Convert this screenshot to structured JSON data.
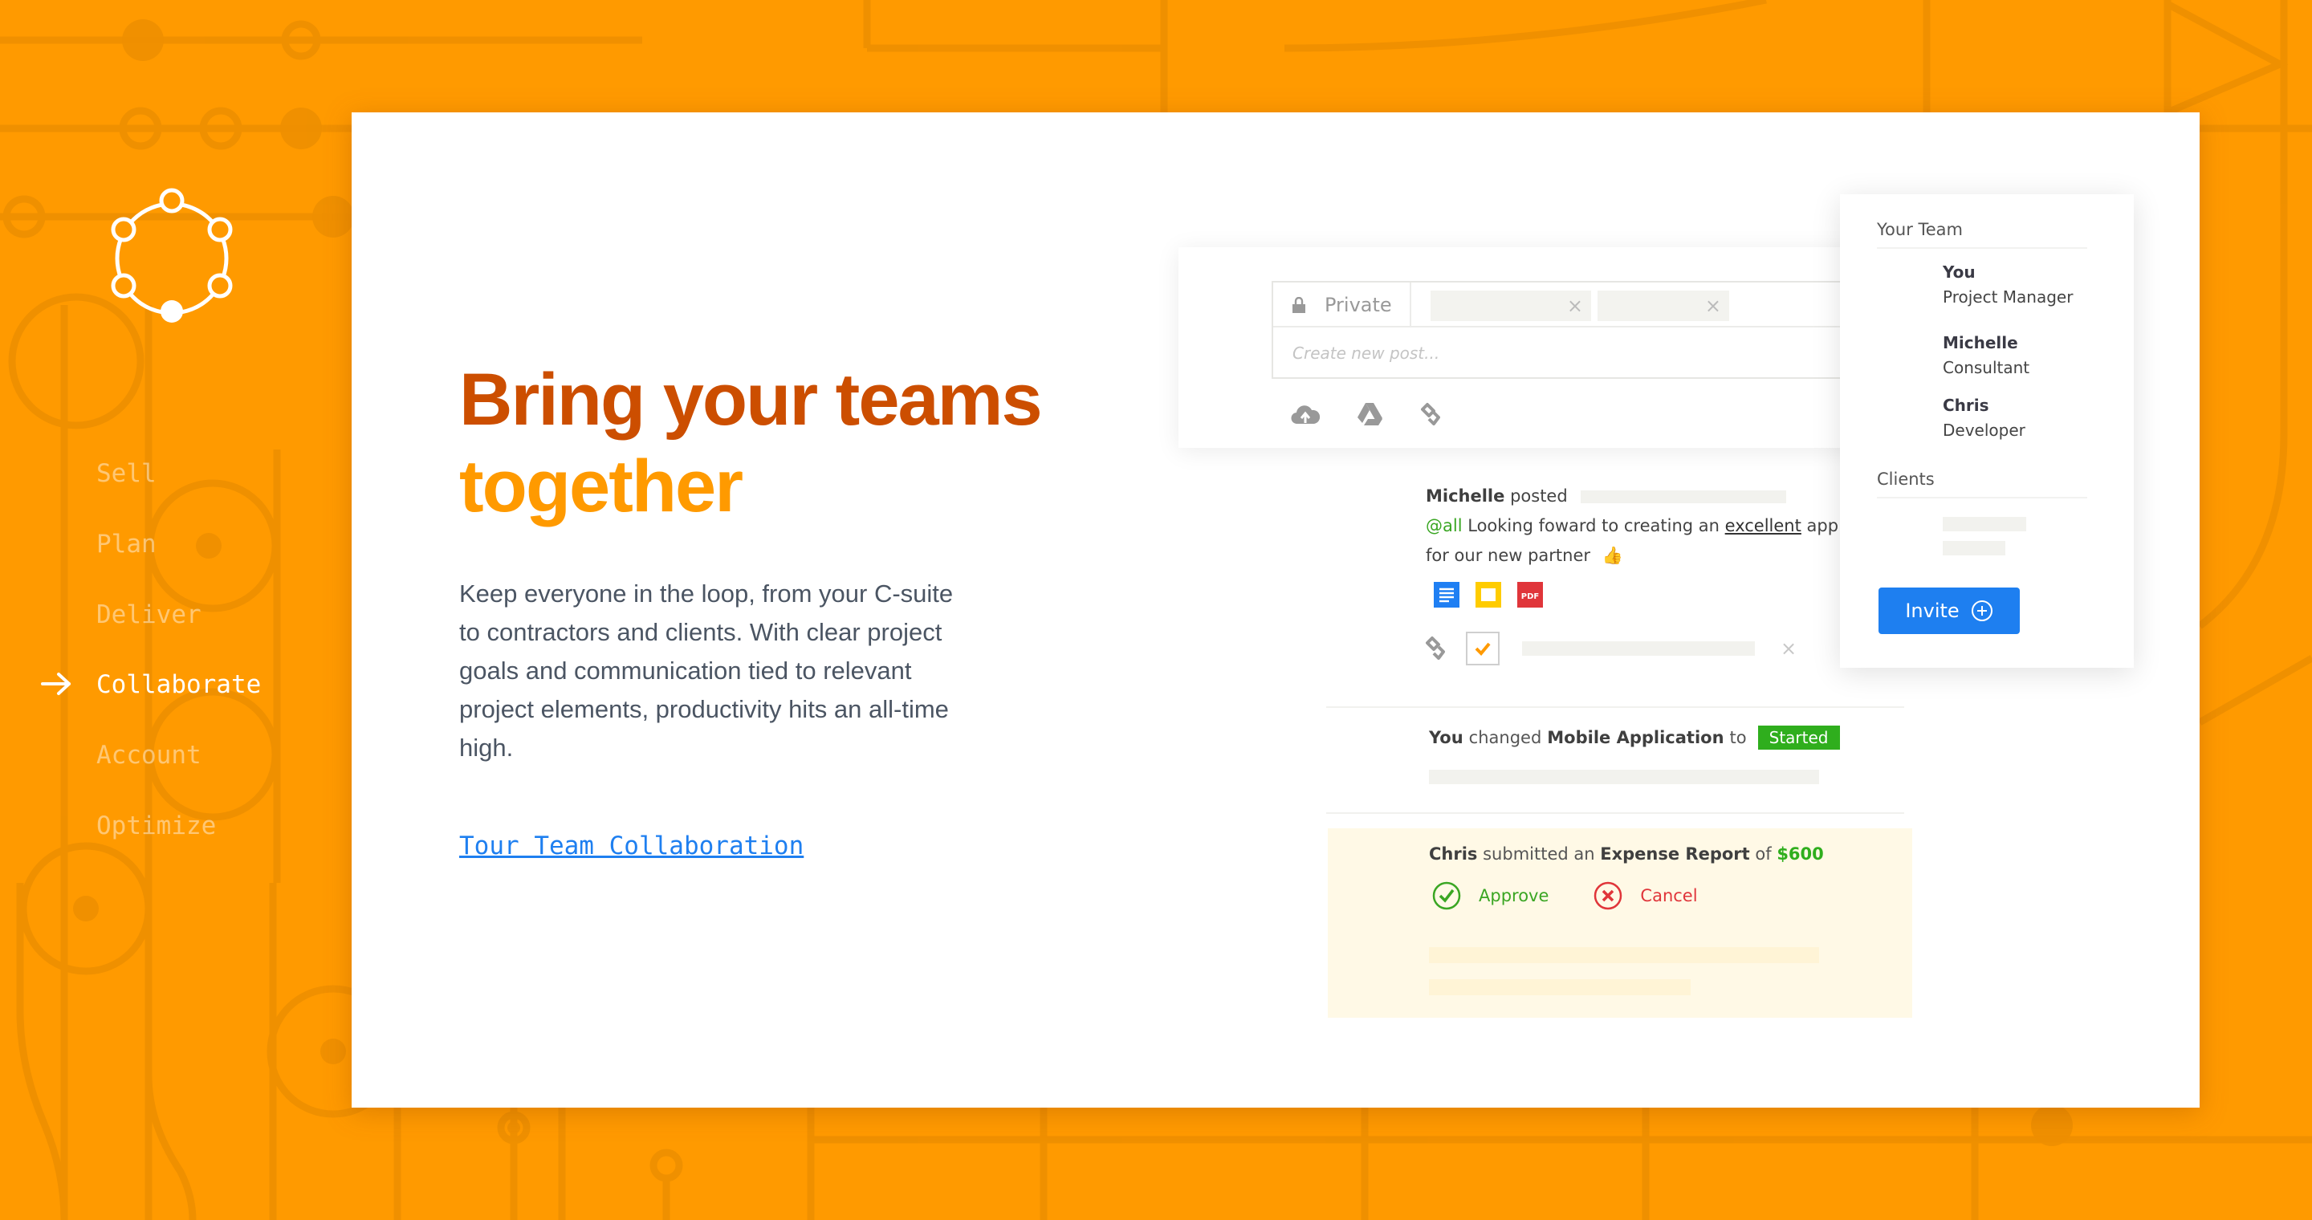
{
  "brand": {
    "logo_icon": "circle-network-icon"
  },
  "nav": {
    "items": [
      {
        "label": "Sell",
        "active": false
      },
      {
        "label": "Plan",
        "active": false
      },
      {
        "label": "Deliver",
        "active": false
      },
      {
        "label": "Collaborate",
        "active": true
      },
      {
        "label": "Account",
        "active": false
      },
      {
        "label": "Optimize",
        "active": false
      }
    ],
    "active_indicator_icon": "arrow-right-icon"
  },
  "hero": {
    "headline_line1": "Bring your teams",
    "headline_line2": "together",
    "body": "Keep everyone in the loop, from your C-suite to contractors and clients. With clear project goals and communication tied to relevant project elements, productivity hits an all-time high.",
    "link_label": "Tour Team Collaboration"
  },
  "composer": {
    "privacy_label": "Private",
    "privacy_icon": "lock-icon",
    "chip_close": "×",
    "post_placeholder": "Create new post...",
    "tools": [
      "cloud-upload-icon",
      "google-drive-icon",
      "link-icon"
    ]
  },
  "feed": {
    "post": {
      "author": "Michelle",
      "verb": "posted",
      "mention": "@all",
      "text_before": "Looking foward to creating an",
      "underlined": "excellent",
      "text_after": "app for our new partner",
      "emoji": "👍",
      "attachments": [
        "google-docs-icon",
        "google-slides-icon",
        "pdf-icon"
      ],
      "pdf_label": "PDF",
      "remove": "×"
    },
    "status_change": {
      "actor": "You",
      "verb": "changed",
      "object": "Mobile Application",
      "preposition": "to",
      "status": "Started"
    },
    "expense": {
      "actor": "Chris",
      "verb": "submitted an",
      "object": "Expense Report",
      "preposition": "of",
      "amount": "$600",
      "approve_label": "Approve",
      "cancel_label": "Cancel"
    }
  },
  "team": {
    "title": "Your Team",
    "members": [
      {
        "name": "You",
        "role": "Project Manager"
      },
      {
        "name": "Michelle",
        "role": "Consultant"
      },
      {
        "name": "Chris",
        "role": "Developer"
      }
    ],
    "clients_title": "Clients",
    "invite_label": "Invite"
  },
  "colors": {
    "background": "#ff9a00",
    "headline_dark": "#cc4e00",
    "headline_light": "#ff9a00",
    "link": "#1e7ff0",
    "success": "#2fae1d",
    "danger": "#e0353a",
    "expense_bg": "#fff9e6"
  }
}
